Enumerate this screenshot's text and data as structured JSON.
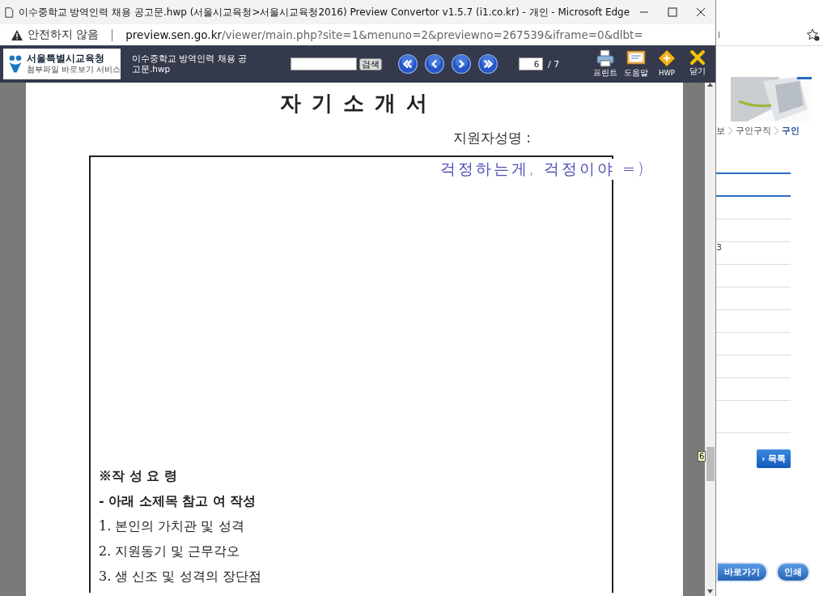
{
  "window": {
    "title": "이수중학교 방역인력 채용 공고문.hwp (서울시교육청>서울시교육청2016) Preview Convertor v1.5.7 (i1.co.kr) - 개인 - Microsoft Edge"
  },
  "address_bar": {
    "security": "안전하지 않음",
    "url_host": "preview.sen.go.kr",
    "url_path": "/viewer/main.php?site=1&menuno=2&previewno=267539&iframe=0&dlbt="
  },
  "toolbar": {
    "logo_name": "서울특별시교육청",
    "logo_subtitle": "첨부파일 바로보기 서비스",
    "file_name": "이수중학교 방역인력 채용 공고문.hwp",
    "search_button": "검색",
    "page": "6",
    "page_total": "/ 7",
    "tools": [
      {
        "kind": "print",
        "label": "프린트"
      },
      {
        "kind": "help",
        "label": "도움말"
      },
      {
        "kind": "hwp",
        "label": "HWP"
      },
      {
        "kind": "close",
        "label": "닫기"
      }
    ]
  },
  "document": {
    "title": "자 기 소 개 서",
    "applicant_label": "지원자성명 :",
    "handwriting": "걱정하는게, 걱정이야 =)",
    "guide_heading": "※작 성 요 령",
    "guide_subheading": "- 아래 소제목 참고  여 작성",
    "guide_items": [
      "1. 본인의 가치관 및 성격",
      "2. 지원동기 및 근무각오",
      "3. 생  신조 및 성격의 장단점"
    ]
  },
  "background_page": {
    "address_fragment": "l",
    "breadcrumb": [
      {
        "label": "보",
        "selected": false
      },
      {
        "label": "구인구직",
        "selected": false
      },
      {
        "label": "구인",
        "selected": true
      }
    ],
    "cell_fragment": "3",
    "tooltip": "6",
    "list_button": "› 목록",
    "buttons": [
      "바로가기",
      "인쇄"
    ]
  }
}
